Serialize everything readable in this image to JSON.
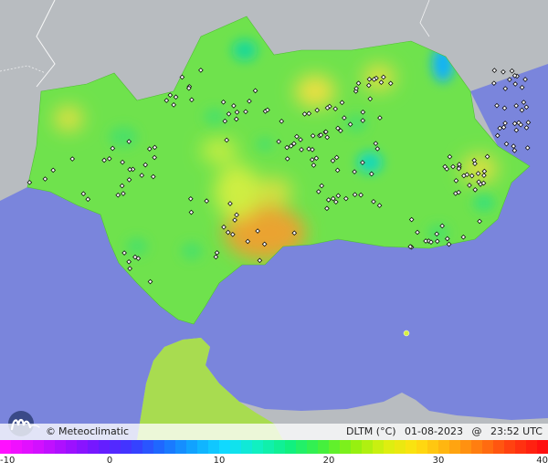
{
  "brand": {
    "copyright": "©",
    "name": "Meteoclimatic"
  },
  "header": {
    "variable": "DLTM (°C)",
    "date": "01-08-2023",
    "separator": "@",
    "time": "23:52 UTC"
  },
  "legend": {
    "min": -10,
    "max": 40,
    "labels": [
      "-10",
      "0",
      "10",
      "20",
      "30",
      "40"
    ],
    "colors": [
      "#ff10ff",
      "#d410ff",
      "#a010ff",
      "#6a1aff",
      "#3a3aff",
      "#1b6eff",
      "#10a8ff",
      "#10dcff",
      "#10f0c0",
      "#10f080",
      "#40f040",
      "#90f010",
      "#d8f010",
      "#ffe010",
      "#ffb010",
      "#ff7a10",
      "#ff4010",
      "#ff1010"
    ]
  },
  "map": {
    "sea_color": "#7a85dc",
    "land_color": "#b8bcc0",
    "region_color": "#6fe24d",
    "station_count_shown": 200
  }
}
